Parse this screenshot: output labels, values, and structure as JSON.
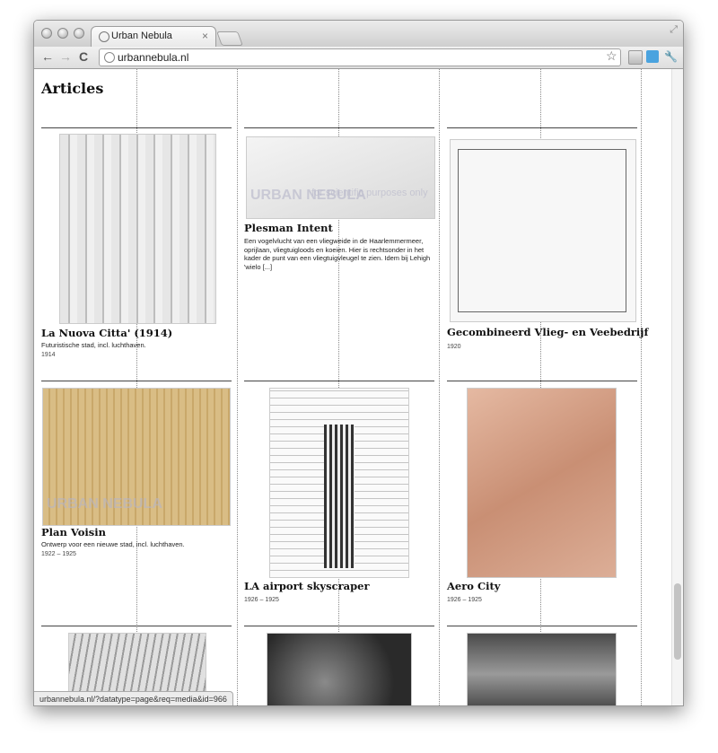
{
  "browser": {
    "tab_title": "Urban Nebula",
    "tab_close": "×",
    "url": "urbannebula.nl",
    "back_glyph": "←",
    "forward_glyph": "→",
    "reload_glyph": "C",
    "star_glyph": "☆",
    "wrench_glyph": "🔧",
    "resize_glyph": "⤢",
    "status_url": "urbannebula.nl/?datatype=page&req=media&id=966",
    "icons": [
      "globe-icon",
      "back-icon",
      "forward-icon",
      "reload-icon",
      "star-icon",
      "wrench-icon"
    ]
  },
  "page": {
    "title": "Articles"
  },
  "articles": [
    {
      "title": "La Nuova Citta' (1914)",
      "desc": "Futuristische stad, incl. luchthaven.",
      "date": "1914"
    },
    {
      "title": "Plesman Intent",
      "desc": "Een vogelvlucht van een vliegweide in de Haarlemmermeer, oprijlaan, vliegtuigloods en koeien. Hier is rechtsonder in het kader de punt van een vliegtuigvleugel te zien. Idem bij Lehigh 'wielo [...]",
      "date": ""
    },
    {
      "title": "Gecombineerd Vlieg- en Veebedrijf",
      "desc": "",
      "date": "1920"
    },
    {
      "title": "Plan Voisin",
      "desc": "Ontwerp voor een nieuwe stad, incl. luchthaven.",
      "date": "1922 – 1925"
    },
    {
      "title": "LA airport skyscraper",
      "desc": "",
      "date": "1926 – 1925"
    },
    {
      "title": "Aero City",
      "desc": "",
      "date": "1926 – 1925"
    }
  ],
  "watermark": {
    "brand": "URBAN NEBULA",
    "note": "for scientific purposes only"
  },
  "colors": {
    "sepia": "#c9a86a",
    "rose": "#d9a58c",
    "gray": "#cfcfcf",
    "dark": "#2a2a2a"
  }
}
